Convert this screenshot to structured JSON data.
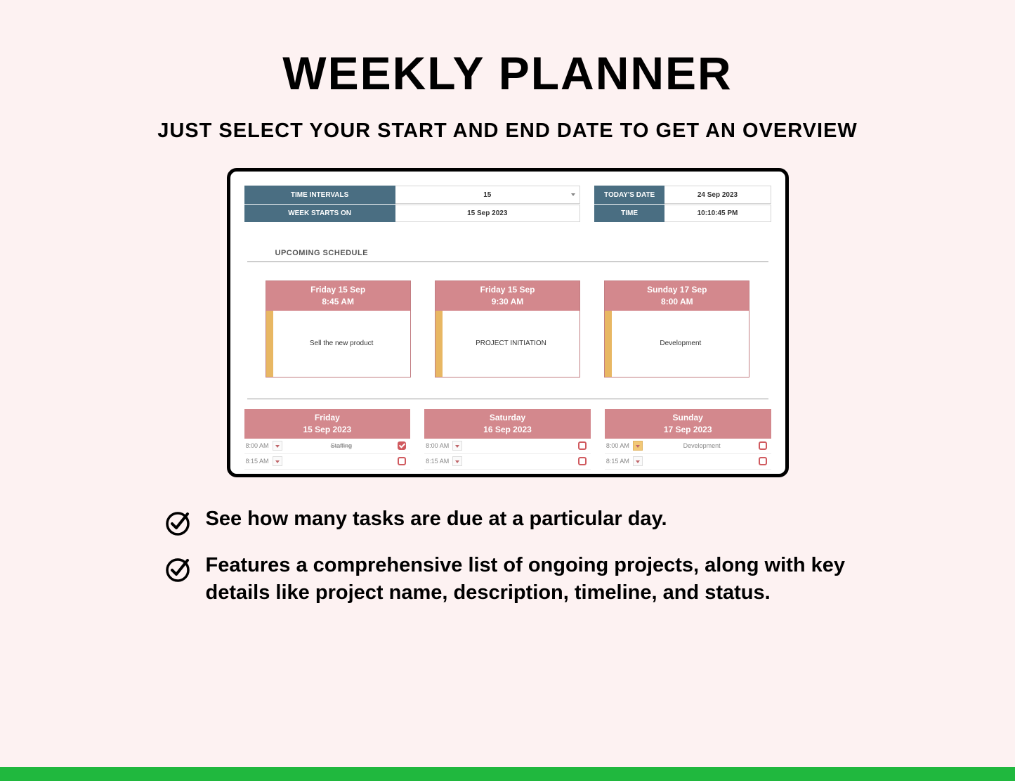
{
  "title": "WEEKLY PLANNER",
  "subtitle": "JUST SELECT YOUR START AND END DATE TO GET AN OVERVIEW",
  "settings": {
    "time_intervals_label": "TIME INTERVALS",
    "time_intervals_value": "15",
    "week_starts_label": "WEEK STARTS ON",
    "week_starts_value": "15 Sep 2023",
    "todays_date_label": "TODAY'S DATE",
    "todays_date_value": "24 Sep 2023",
    "time_label": "TIME",
    "time_value": "10:10:45 PM"
  },
  "upcoming_label": "UPCOMING SCHEDULE",
  "cards": [
    {
      "day": "Friday 15 Sep",
      "time": "8:45 AM",
      "task": "Sell the new product"
    },
    {
      "day": "Friday 15 Sep",
      "time": "9:30 AM",
      "task": "PROJECT INITIATION"
    },
    {
      "day": "Sunday 17 Sep",
      "time": "8:00 AM",
      "task": "Development"
    }
  ],
  "days": [
    {
      "name": "Friday",
      "date": "15 Sep 2023",
      "slots": [
        {
          "time": "8:00 AM",
          "task": "Staffing",
          "done": true,
          "strike": true,
          "amber": false
        },
        {
          "time": "8:15 AM",
          "task": "",
          "done": false,
          "strike": false,
          "amber": false
        }
      ]
    },
    {
      "name": "Saturday",
      "date": "16 Sep 2023",
      "slots": [
        {
          "time": "8:00 AM",
          "task": "",
          "done": false,
          "strike": false,
          "amber": false
        },
        {
          "time": "8:15 AM",
          "task": "",
          "done": false,
          "strike": false,
          "amber": false
        }
      ]
    },
    {
      "name": "Sunday",
      "date": "17 Sep 2023",
      "slots": [
        {
          "time": "8:00 AM",
          "task": "Development",
          "done": false,
          "strike": false,
          "amber": true
        },
        {
          "time": "8:15 AM",
          "task": "",
          "done": false,
          "strike": false,
          "amber": false
        }
      ]
    }
  ],
  "bullets": [
    "See how many tasks are due at a particular day.",
    "Features a comprehensive list of ongoing projects, along with key details like project name, description, timeline, and status."
  ]
}
